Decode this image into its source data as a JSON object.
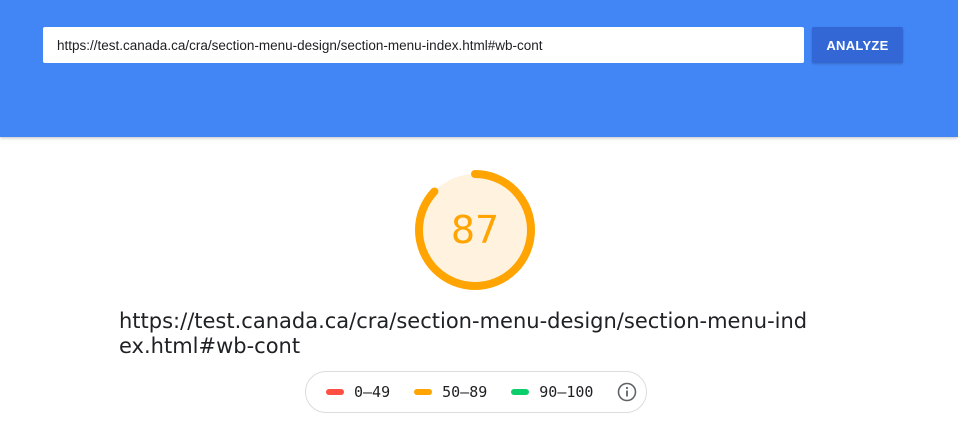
{
  "header": {
    "url_value": "https://test.canada.ca/cra/section-menu-design/section-menu-index.html#wb-cont",
    "analyze_label": "ANALYZE",
    "background_color": "#4285f4",
    "button_color": "#3367d6"
  },
  "score": {
    "value": "87",
    "fraction": 0.87,
    "color": "#ffa400",
    "fill_color": "#fff3e0"
  },
  "final_url": "https://test.canada.ca/cra/section-menu-design/section-menu-index.html#wb-cont",
  "legend": {
    "items": [
      {
        "label": "0–49",
        "color": "#ff4e42"
      },
      {
        "label": "50–89",
        "color": "#ffa400"
      },
      {
        "label": "90–100",
        "color": "#0cce6b"
      }
    ],
    "info_icon": "info-icon"
  }
}
